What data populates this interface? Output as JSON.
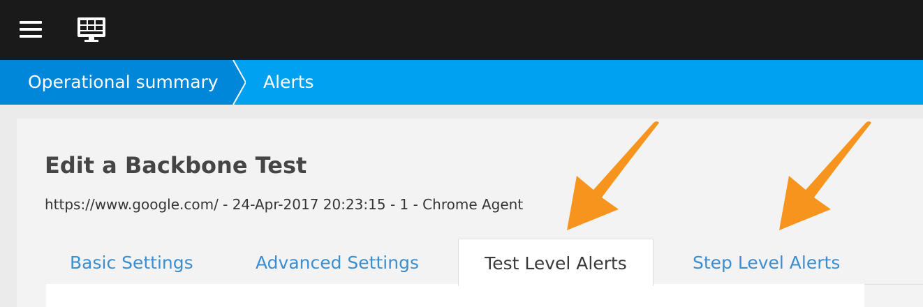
{
  "topbar": {
    "menu_icon": "hamburger-menu-icon",
    "dashboard_icon": "dashboard-monitor-icon",
    "background": "#1a1a1a"
  },
  "breadcrumb": {
    "items": [
      {
        "label": "Operational summary"
      },
      {
        "label": "Alerts"
      }
    ],
    "background": "#00a1f1",
    "active_background": "#0087d9"
  },
  "page": {
    "title": "Edit a Backbone Test",
    "subtitle": "https://www.google.com/ - 24-Apr-2017 20:23:15 - 1 - Chrome Agent"
  },
  "tabs": [
    {
      "label": "Basic Settings",
      "active": false
    },
    {
      "label": "Advanced Settings",
      "active": false
    },
    {
      "label": "Test Level Alerts",
      "active": true
    },
    {
      "label": "Step Level Alerts",
      "active": false
    }
  ],
  "annotations": {
    "arrow_color": "#f7941d",
    "arrow_icon": "orange-pointer-arrow-icon"
  },
  "colors": {
    "link": "#3b8ed0",
    "title": "#454545"
  }
}
